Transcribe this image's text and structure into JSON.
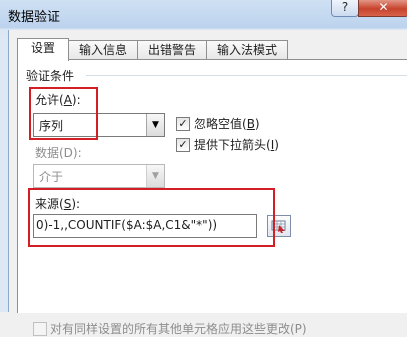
{
  "window": {
    "title": "数据验证",
    "help_label": "?",
    "close_label": "✕"
  },
  "tabs": [
    {
      "label": "设置",
      "active": true
    },
    {
      "label": "输入信息",
      "active": false
    },
    {
      "label": "出错警告",
      "active": false
    },
    {
      "label": "输入法模式",
      "active": false
    }
  ],
  "settings": {
    "group_title": "验证条件",
    "allow": {
      "label_pre": "允许(",
      "label_key": "A",
      "label_post": "):",
      "value": "序列"
    },
    "ignore_blank": {
      "label_pre": "忽略空值(",
      "label_key": "B",
      "label_post": ")",
      "checked": true
    },
    "dropdown": {
      "label_pre": "提供下拉箭头(",
      "label_key": "I",
      "label_post": ")",
      "checked": true
    },
    "data": {
      "label": "数据(D):",
      "value": "介于"
    },
    "source": {
      "label_pre": "来源(",
      "label_key": "S",
      "label_post": "):",
      "value": "0)-1,,COUNTIF($A:$A,C1&\"*\"))"
    },
    "apply_all": {
      "label": "对有同样设置的所有其他单元格应用这些更改(P)",
      "checked": false
    }
  },
  "colors": {
    "highlight": "#d11f24"
  },
  "icons": {
    "collapse": "range-select-icon",
    "dropdown": "chevron-down-icon"
  }
}
